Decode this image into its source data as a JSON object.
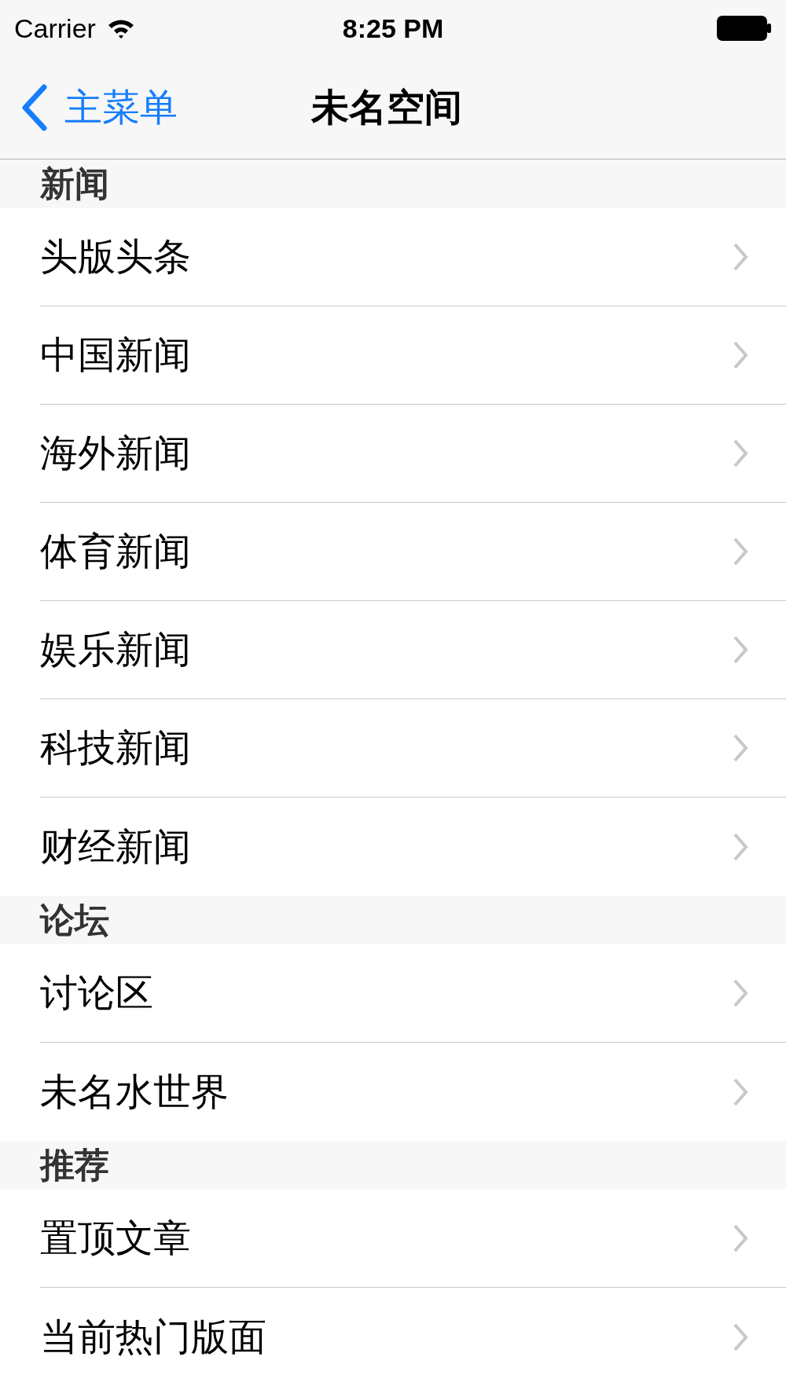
{
  "status_bar": {
    "carrier": "Carrier",
    "time": "8:25 PM"
  },
  "nav_bar": {
    "back_label": "主菜单",
    "title": "未名空间"
  },
  "sections": [
    {
      "title": "新闻",
      "rows": [
        {
          "label": "头版头条"
        },
        {
          "label": "中国新闻"
        },
        {
          "label": "海外新闻"
        },
        {
          "label": "体育新闻"
        },
        {
          "label": "娱乐新闻"
        },
        {
          "label": "科技新闻"
        },
        {
          "label": "财经新闻"
        }
      ]
    },
    {
      "title": "论坛",
      "rows": [
        {
          "label": "讨论区"
        },
        {
          "label": "未名水世界"
        }
      ]
    },
    {
      "title": "推荐",
      "rows": [
        {
          "label": "置顶文章"
        },
        {
          "label": "当前热门版面"
        }
      ]
    }
  ]
}
